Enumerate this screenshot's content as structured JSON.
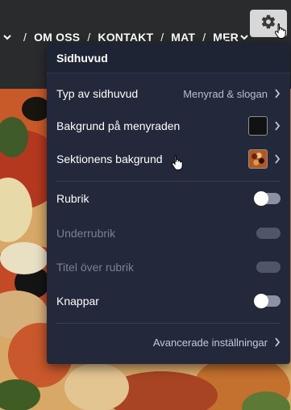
{
  "nav": {
    "items": [
      "OM OSS",
      "KONTAKT",
      "MAT",
      "MER"
    ],
    "separator": "/"
  },
  "icons": {
    "gear": "gear-icon",
    "cursor": "hand-pointer-icon",
    "chevron": "chevron-right-icon"
  },
  "panel": {
    "title": "Sidhuvud",
    "rows": [
      {
        "label": "Typ av sidhuvud",
        "value": "Menyrad & slogan"
      },
      {
        "label": "Bakgrund på menyraden",
        "swatch": "#121212"
      },
      {
        "label": "Sektionens bakgrund",
        "swatch": "pizza-image"
      }
    ],
    "toggles": [
      {
        "label": "Rubrik",
        "state": "off",
        "enabled": true
      },
      {
        "label": "Underrubrik",
        "state": "off",
        "enabled": false
      },
      {
        "label": "Titel över rubrik",
        "state": "off",
        "enabled": false
      },
      {
        "label": "Knappar",
        "state": "off",
        "enabled": true
      }
    ],
    "advanced_label": "Avancerade inställningar"
  },
  "colors": {
    "panel_bg": "#23283a",
    "header_bg": "#2a2b2d",
    "disabled_text": "#7b8196"
  }
}
